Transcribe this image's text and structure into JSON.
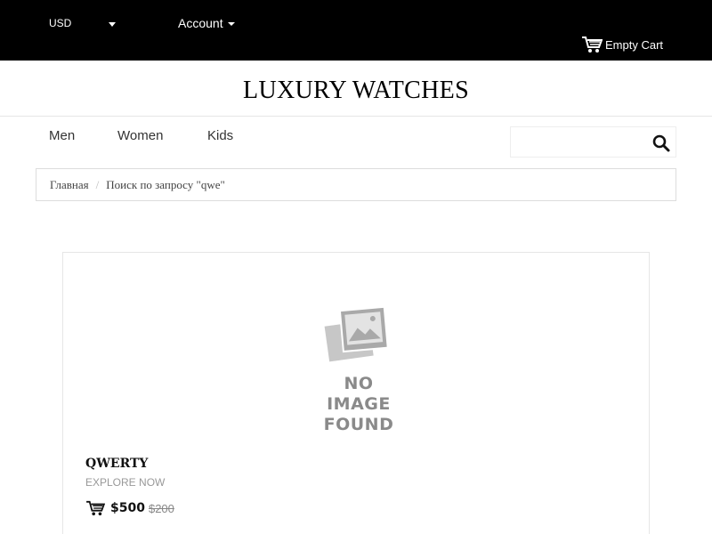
{
  "topbar": {
    "currency": "USD",
    "account_label": "Account",
    "cart_label": "Empty Cart",
    "cart_icon": "cart-icon"
  },
  "logo": {
    "text": "LUXURY WATCHES"
  },
  "nav": {
    "items": [
      {
        "label": "Men"
      },
      {
        "label": "Women"
      },
      {
        "label": "Kids"
      }
    ],
    "search": {
      "placeholder": "",
      "value": "",
      "icon": "search-icon"
    }
  },
  "breadcrumb": {
    "home": "Главная",
    "separator": "/",
    "current": "Поиск по запросу \"qwe\""
  },
  "product": {
    "image_text_line1": "NO IMAGE",
    "image_text_line2": "FOUND",
    "name": "QWERTY",
    "explore": "EXPLORE NOW",
    "price": "$500",
    "old_price": "$200",
    "cart_icon": "cart-icon"
  },
  "colors": {
    "topbar_bg": "#000000",
    "text": "#333333",
    "muted": "#999999",
    "border": "#e6e6e6"
  }
}
